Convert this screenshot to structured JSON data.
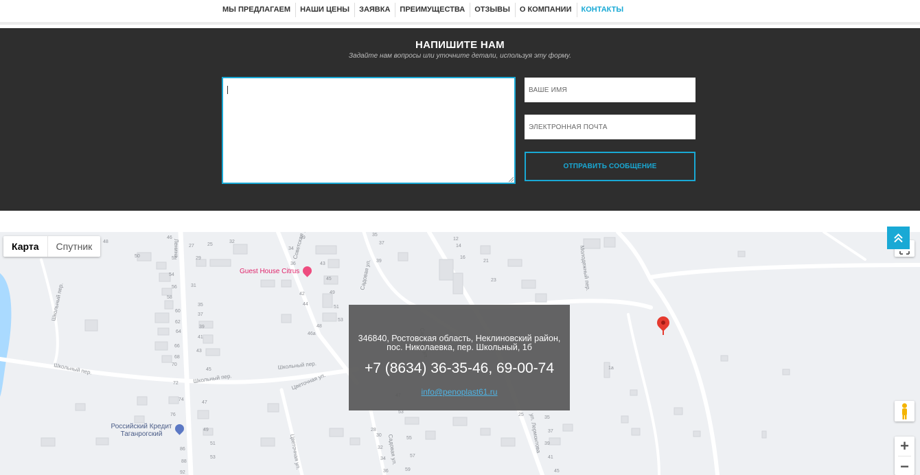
{
  "nav": {
    "items": [
      {
        "label": "МЫ ПРЕДЛАГАЕМ"
      },
      {
        "label": "НАШИ ЦЕНЫ"
      },
      {
        "label": "ЗАЯВКА"
      },
      {
        "label": "ПРЕИМУЩЕСТВА"
      },
      {
        "label": "ОТЗЫВЫ"
      },
      {
        "label": "О КОМПАНИИ"
      },
      {
        "label": "КОНТАКТЫ"
      }
    ],
    "active": "КОНТАКТЫ"
  },
  "contact": {
    "title": "НАПИШИТЕ НАМ",
    "subtitle": "Задайте нам вопросы или уточните детали, используя эту форму.",
    "message_value": "",
    "name_placeholder": "ВАШЕ ИМЯ",
    "email_placeholder": "ЭЛЕКТРОННАЯ ПОЧТА",
    "submit_label": "ОТПРАВИТЬ СООБЩЕНИЕ"
  },
  "map": {
    "type_map": "Карта",
    "type_satellite": "Спутник",
    "poi_guesthouse": "Guest House Citrus",
    "poi_bank_line1": "Российский Кредит",
    "poi_bank_line2": "Таганрогский",
    "info": {
      "address_line1": "346840, Ростовская область, Неклиновский район,",
      "address_line2": "пос. Николаевка, пер. Школьный, 1б",
      "phone": "+7 (8634) 36-35-46, 69-00-74",
      "email": "info@penoplast61.ru"
    },
    "zoom_in": "+",
    "zoom_out": "−"
  },
  "colors": {
    "accent": "#19a9d5",
    "dark_section": "#2e2e2e",
    "marker": "#e53a2f"
  },
  "icons": [
    "fullscreen-icon",
    "pegman-icon",
    "map-marker-icon",
    "scroll-to-top-icon"
  ]
}
